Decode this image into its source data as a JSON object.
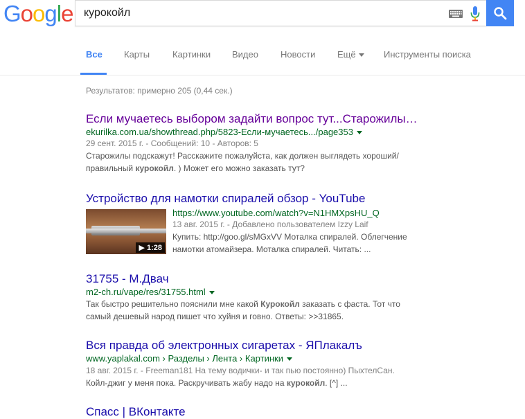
{
  "logo": {
    "letters": [
      "G",
      "o",
      "o",
      "g",
      "l",
      "e"
    ],
    "colors": [
      "#4285f4",
      "#ea4335",
      "#fbbc05",
      "#4285f4",
      "#34a853",
      "#ea4335"
    ]
  },
  "search": {
    "query": "курокойл"
  },
  "tabs": [
    {
      "label": "Все",
      "active": true
    },
    {
      "label": "Карты"
    },
    {
      "label": "Картинки"
    },
    {
      "label": "Видео"
    },
    {
      "label": "Новости"
    },
    {
      "label": "Ещё"
    },
    {
      "label": "Инструменты поиска"
    }
  ],
  "stats": "Результатов: примерно 205 (0,44 сек.)",
  "results": [
    {
      "title": "Если мучаетесь выбором задайти вопрос тут...Старожилы…",
      "url": "ekurilka.com.ua/showthread.php/5823-Если-мучаетесь.../page353",
      "meta": "29 сент. 2015 г. - Сообщений: 10 - Авторов: 5",
      "snippet_1": "Старожилы подскажут! Расскажите пожалуйста, как должен выглядеть хороший/",
      "snippet_2a": "правильный ",
      "snippet_2b": "курокойл",
      "snippet_2c": ". ) Может его можно заказать тут?"
    },
    {
      "title": "Устройство для намотки спиралей обзор - YouTube",
      "url": "https://www.youtube.com/watch?v=N1HMXpsHU_Q",
      "meta": "13 авг. 2015 г. - Добавлено пользователем Izzy Laif",
      "snippet_1": "Купить: http://goo.gl/sMGxVV Моталка спиралей. Облегчение",
      "snippet_2": "намотки атомайзера. Моталка спиралей. Читать: ...",
      "duration": "1:28"
    },
    {
      "title": "31755 - М.Двач",
      "url": "m2-ch.ru/vape/res/31755.html",
      "snippet_1a": "Так быстро решительно пояснили мне какой ",
      "snippet_1b": "Курокойл",
      "snippet_1c": " заказать с фаста. Тот что",
      "snippet_2": "самый дешевый народ пишет что хуйня и говно. Ответы: >>31865."
    },
    {
      "title": "Вся правда об электронных сигаретах - ЯПлакалъ",
      "url": "www.yaplakal.com › Разделы › Лента › Картинки",
      "meta": "18 авг. 2015 г. - Freeman181 На тему водички- и так пью постоянно) ПыхтелСан.",
      "snippet_1a": "Койл-джиг у меня пока. Раскручивать жабу надо на ",
      "snippet_1b": "курокойл",
      "snippet_1c": ". [^]  ..."
    }
  ],
  "partial_title": "Спасс | ВКонтакте"
}
